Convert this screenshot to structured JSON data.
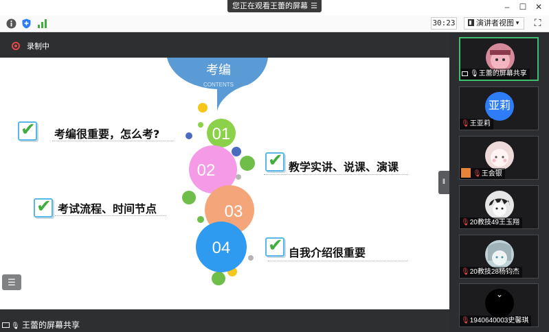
{
  "banner": {
    "text": "您正在观看王蕾的屏幕",
    "menu_icon": "menu-icon"
  },
  "window": {
    "minimize": "–",
    "maximize": "☐",
    "close": "✕"
  },
  "toolbar": {
    "timer": "30:23",
    "view_label": "演讲者视图",
    "info_icon": "info-icon",
    "shield_icon": "shield-icon",
    "signal_icon": "signal-icon"
  },
  "recording": {
    "label": "录制中"
  },
  "slide": {
    "header_title": "考编",
    "header_subtitle": "CONTENTS",
    "numbers": [
      "01",
      "02",
      "03",
      "04"
    ],
    "items": [
      "考编很重要，怎么考?",
      "教学实讲、说课、演课",
      "考试流程、时间节点",
      "自我介绍很重要"
    ],
    "colors": {
      "blue_header": "#5b9bd5",
      "c01": "#8bd14a",
      "c02": "#f59ae6",
      "c03": "#f4a57a",
      "c04": "#2f9bf0"
    }
  },
  "share_footer": {
    "label": "王蕾的屏幕共享"
  },
  "participants": [
    {
      "name": "王蕾的屏幕共享",
      "avatar": "photo",
      "active": true
    },
    {
      "name": "王亚莉",
      "avatar_text": "亚莉"
    },
    {
      "name": "王会银",
      "avatar": "photo"
    },
    {
      "name": "20教技49王玉翔",
      "avatar": "photo"
    },
    {
      "name": "20教技28杨钧杰",
      "avatar": "photo"
    },
    {
      "name": "1940640003史馨琪",
      "avatar": "photo"
    }
  ]
}
